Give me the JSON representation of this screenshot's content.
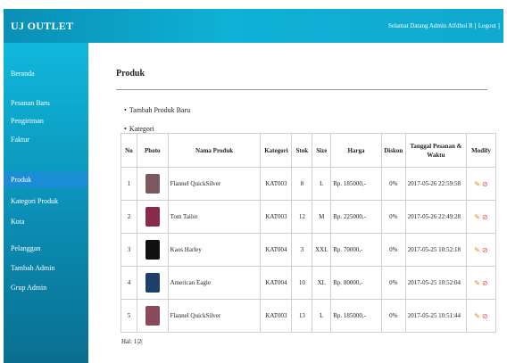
{
  "header": {
    "brand": "UJ OUTLET",
    "welcome_prefix": "Selamat Datang Admin Alfdhol R",
    "logout": "[ Logout ]"
  },
  "sidebar": {
    "items": [
      {
        "label": "Beranda",
        "active": false
      },
      {
        "label": "Pesanan Baru",
        "active": false
      },
      {
        "label": "Pengiriman",
        "active": false
      },
      {
        "label": "Faktur",
        "active": false
      },
      {
        "label": "Produk",
        "active": true
      },
      {
        "label": "Kategori Produk",
        "active": false
      },
      {
        "label": "Kota",
        "active": false
      },
      {
        "label": "Pelanggan",
        "active": false
      },
      {
        "label": "Tambah Admin",
        "active": false
      },
      {
        "label": "Grup Admin",
        "active": false
      }
    ]
  },
  "main": {
    "title": "Produk",
    "links": [
      "Tambah Produk Baru",
      "Kategori"
    ]
  },
  "table": {
    "columns": [
      "No",
      "Photo",
      "Nama Produk",
      "Kategori",
      "Stok",
      "Size",
      "Harga",
      "Diskon",
      "Tanggal Pesanan & Waktu",
      "Modify"
    ],
    "rows": [
      {
        "no": "1",
        "photo": "plaid shirt",
        "photo_color": "#7a5a5f",
        "nama": "Flannel QuickSilver",
        "kategori": "KAT003",
        "stok": "8",
        "size": "L",
        "harga": "Rp. 185000,-",
        "diskon": "0%",
        "tanggal": "2017-05-26 22:59:58"
      },
      {
        "no": "2",
        "photo": "maroon shirt",
        "photo_color": "#8a2a4a",
        "nama": "Tom Tailor",
        "kategori": "KAT003",
        "stok": "12",
        "size": "M",
        "harga": "Rp. 225000,-",
        "diskon": "0%",
        "tanggal": "2017-05-26 22:49:28"
      },
      {
        "no": "3",
        "photo": "black t-shirt",
        "photo_color": "#111111",
        "nama": "Kaos Harley",
        "kategori": "KAT004",
        "stok": "3",
        "size": "XXL",
        "harga": "Rp. 70000,-",
        "diskon": "0%",
        "tanggal": "2017-05-25 10:52:18"
      },
      {
        "no": "4",
        "photo": "navy t-shirt",
        "photo_color": "#1d3f6b",
        "nama": "American Eagle",
        "kategori": "KAT004",
        "stok": "10",
        "size": "XL",
        "harga": "Rp. 80000,-",
        "diskon": "0%",
        "tanggal": "2017-05-25 10:52:04"
      },
      {
        "no": "5",
        "photo": "plaid shirt",
        "photo_color": "#8a4a5a",
        "nama": "Flannel QuickSilver",
        "kategori": "KAT003",
        "stok": "13",
        "size": "L",
        "harga": "Rp. 185000,-",
        "diskon": "0%",
        "tanggal": "2017-05-25 10:51:44"
      }
    ]
  },
  "pager": {
    "label": "Hal:",
    "pages": [
      "1",
      "2"
    ]
  },
  "icons": {
    "edit": "pencil-icon",
    "delete": "delete-icon"
  },
  "colors": {
    "topbar": "#0fb1d6",
    "sidebar_active": "#1a8dd6",
    "edit_icon": "#d98b1a",
    "delete_icon": "#e05a3a"
  }
}
